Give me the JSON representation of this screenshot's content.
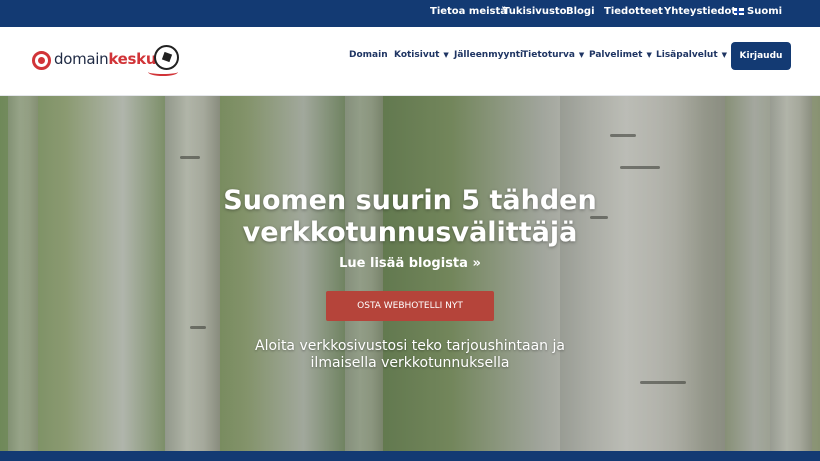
{
  "topbar": {
    "links": [
      "Tietoa meistä",
      "Tukisivusto",
      "Blogi",
      "Tiedotteet",
      "Yhteystiedot"
    ],
    "language": "Suomi"
  },
  "header": {
    "logo": {
      "prefix": "domain",
      "brand": "keskus"
    },
    "nav": [
      "Domain",
      "Kotisivut",
      "Jälleenmyynti",
      "Tietoturva",
      "Palvelimet",
      "Lisäpalvelut"
    ],
    "login": "Kirjaudu"
  },
  "hero": {
    "title_line1": "Suomen suurin 5 tähden",
    "title_line2": "verkkotunnusvälittäjä",
    "blog_link": "Lue lisää blogista »",
    "cta": "OSTA WEBHOTELLI NYT",
    "subtitle_line1": "Aloita verkkosivustosi teko tarjoushintaan ja",
    "subtitle_line2": "ilmaisella verkkotunnuksella"
  },
  "colors": {
    "topbar": "#133a73",
    "cta": "#b5443a",
    "accent": "#d13438"
  }
}
